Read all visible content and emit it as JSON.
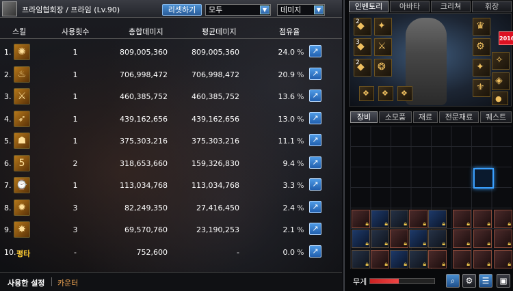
{
  "meter": {
    "title": "프라임협회장 / 프라임 (Lv.90)",
    "reset_label": "리셋하기",
    "filter_target": "모두",
    "filter_metric": "데미지",
    "columns": [
      "스킬",
      "사용횟수",
      "총합데미지",
      "평균데미지",
      "점유율"
    ],
    "rows": [
      {
        "rank": "1.",
        "icon": "flame-skill-icon",
        "glyph": "✺",
        "uses": "1",
        "total": "809,005,360",
        "avg": "809,005,360",
        "share": "24.0"
      },
      {
        "rank": "2.",
        "icon": "fire-wave-skill-icon",
        "glyph": "♨",
        "uses": "1",
        "total": "706,998,472",
        "avg": "706,998,472",
        "share": "20.9"
      },
      {
        "rank": "3.",
        "icon": "slash-skill-icon",
        "glyph": "⚔",
        "uses": "1",
        "total": "460,385,752",
        "avg": "460,385,752",
        "share": "13.6"
      },
      {
        "rank": "4.",
        "icon": "bullet-skill-icon",
        "glyph": "➶",
        "uses": "1",
        "total": "439,162,656",
        "avg": "439,162,656",
        "share": "13.0"
      },
      {
        "rank": "5.",
        "icon": "mask-skill-icon",
        "glyph": "☗",
        "uses": "1",
        "total": "375,303,216",
        "avg": "375,303,216",
        "share": "11.1"
      },
      {
        "rank": "6.",
        "icon": "gear-skill-icon",
        "glyph": "5",
        "uses": "2",
        "total": "318,653,660",
        "avg": "159,326,830",
        "share": "9.4"
      },
      {
        "rank": "7.",
        "icon": "timer-skill-icon",
        "glyph": "⌚",
        "uses": "1",
        "total": "113,034,768",
        "avg": "113,034,768",
        "share": "3.3"
      },
      {
        "rank": "8.",
        "icon": "starburst-skill-icon",
        "glyph": "✹",
        "uses": "3",
        "total": "82,249,350",
        "avg": "27,416,450",
        "share": "2.4"
      },
      {
        "rank": "9.",
        "icon": "explosion-skill-icon",
        "glyph": "✸",
        "uses": "3",
        "total": "69,570,760",
        "avg": "23,190,253",
        "share": "2.1"
      },
      {
        "rank": "10.",
        "icon": "",
        "glyph": "평타",
        "uses": "-",
        "total": "752,600",
        "avg": "-",
        "share": "0.0"
      }
    ],
    "pct_symbol": "%",
    "detail_glyph": "↗",
    "footer": {
      "tab_active": "사용한 설정",
      "tab_other": "카운터"
    }
  },
  "inventory": {
    "tabs": [
      "인벤토리",
      "아바타",
      "크리쳐",
      "휘장"
    ],
    "subtabs": [
      "장비",
      "소모품",
      "재료",
      "전문재료",
      "퀘스트"
    ],
    "badge": "2016",
    "slot_numbers": [
      "2",
      "3",
      "2"
    ],
    "weight_label": "무게",
    "weight_fill_fraction": 0.45,
    "colors": {
      "accent": "#3aa0ff",
      "weight": "#cc2222"
    }
  }
}
